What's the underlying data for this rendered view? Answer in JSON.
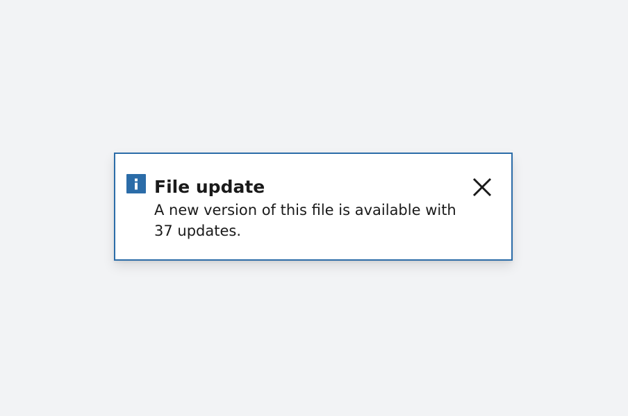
{
  "notification": {
    "type": "info",
    "icon": "info-icon",
    "title": "File update",
    "message": "A new version of this file is available with 37 updates.",
    "close_icon": "close-icon",
    "accent_color": "#2b6ca8"
  }
}
